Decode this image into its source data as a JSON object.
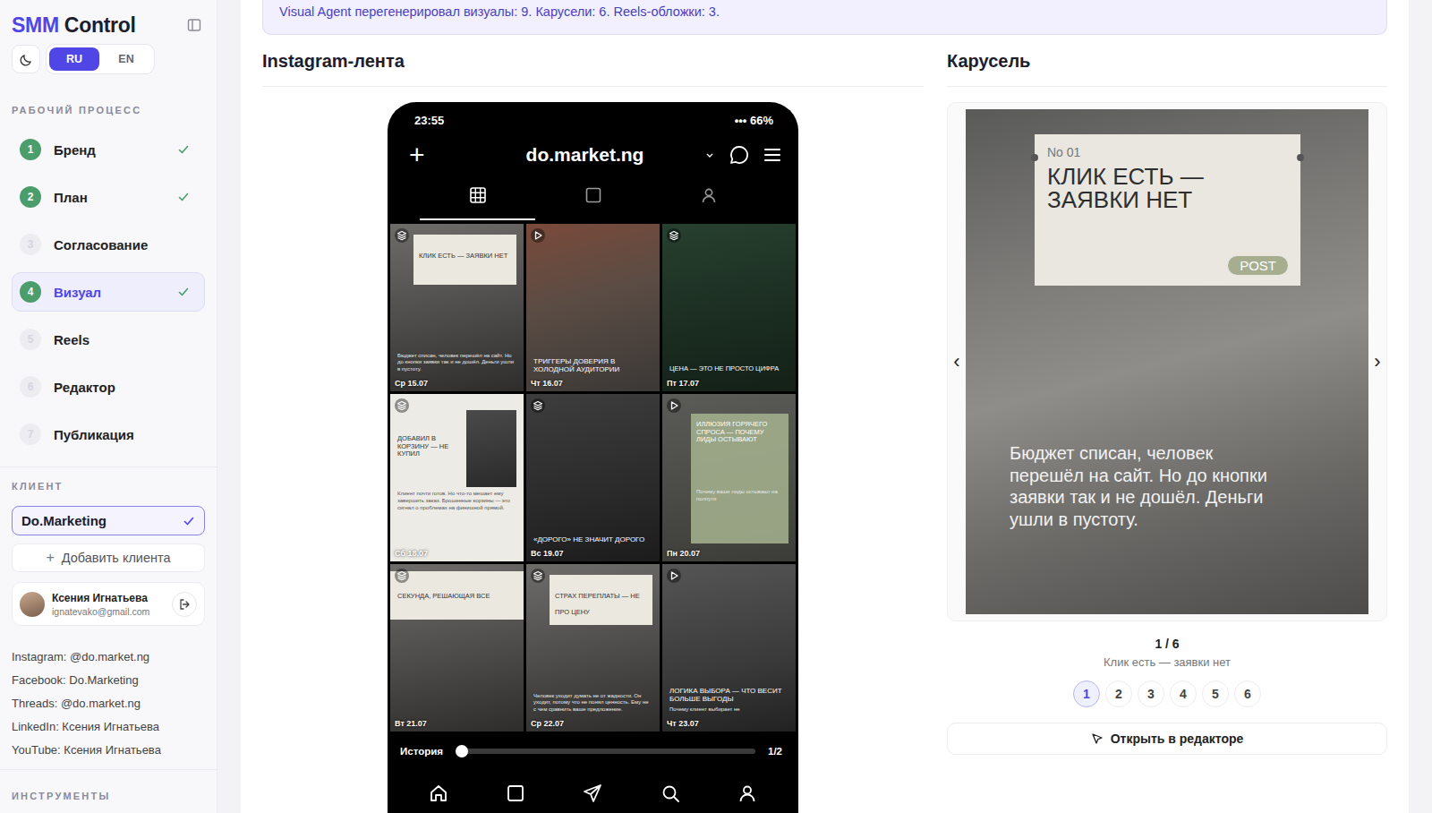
{
  "sidebar": {
    "logo": {
      "accent": "SMM",
      "rest": "Control"
    },
    "languages": [
      {
        "label": "RU",
        "selected": true
      },
      {
        "label": "EN",
        "selected": false
      }
    ],
    "workflow_label": "РАБОЧИЙ ПРОЦЕСС",
    "steps": [
      {
        "number": "1",
        "label": "Бренд",
        "done": true,
        "selected": false
      },
      {
        "number": "2",
        "label": "План",
        "done": true,
        "selected": false
      },
      {
        "number": "3",
        "label": "Согласование",
        "done": false,
        "selected": false
      },
      {
        "number": "4",
        "label": "Визуал",
        "done": true,
        "selected": true
      },
      {
        "number": "5",
        "label": "Reels",
        "done": false,
        "selected": false
      },
      {
        "number": "6",
        "label": "Редактор",
        "done": false,
        "selected": false
      },
      {
        "number": "7",
        "label": "Публикация",
        "done": false,
        "selected": false
      }
    ],
    "client_label": "КЛИЕНТ",
    "client": {
      "name": "Do.Marketing",
      "selected": true
    },
    "add_client": {
      "icon": "+",
      "label": "Добавить клиента"
    },
    "user": {
      "name": "Ксения Игнатьева",
      "email": "ignatevako@gmail.com"
    },
    "socials": [
      "Instagram: @do.market.ng",
      "Facebook: Do.Marketing",
      "Threads: @do.market.ng",
      "LinkedIn: Ксения Игнатьева",
      "YouTube: Ксения Игнатьева"
    ],
    "tools_label": "ИНСТРУМЕНТЫ"
  },
  "banner": "Visual Agent перегенерировал визуалы: 9. Карусели: 6. Reels-обложки: 3.",
  "feed": {
    "title": "Instagram-лента",
    "phone": {
      "time": "23:55",
      "signal": "•••",
      "battery": "66%",
      "new_icon": "+",
      "account": "do.market.ng",
      "profile_tabs": [
        {
          "selected": true
        },
        {
          "selected": false
        },
        {
          "selected": false
        }
      ],
      "posts": [
        {
          "kind": "carousel",
          "design": "card",
          "headline": "КЛИК ЕСТЬ — ЗАЯВКИ НЕТ",
          "body": "Бюджет списан, человек перешёл на сайт. Но до кнопки заявки так и не дошёл. Деньги ушли в пустоту.",
          "date": "Ср 15.07"
        },
        {
          "kind": "reel",
          "design": "photo",
          "headline": "ТРИГГЕРЫ ДОВЕРИЯ В ХОЛОДНОЙ АУДИТОРИИ",
          "body": "",
          "date": "Чт 16.07"
        },
        {
          "kind": "carousel",
          "design": "dark",
          "headline": "ЦЕНА — ЭТО НЕ ПРОСТО ЦИФРА",
          "body": "",
          "date": "Пт 17.07"
        },
        {
          "kind": "carousel",
          "design": "light",
          "headline": "ДОБАВИЛ В КОРЗИНУ — НЕ КУПИЛ",
          "body": "Клиент почти готов. Но что-то мешает ему завершить заказ. Брошенные корзины — это сигнал о проблемах на финишной прямой.",
          "date": "Сб 18.07"
        },
        {
          "kind": "carousel",
          "design": "photo",
          "headline": "«ДОРОГО» НЕ ЗНАЧИТ ДОРОГО",
          "body": "",
          "date": "Вс 19.07"
        },
        {
          "kind": "reel",
          "design": "tint",
          "headline": "ИЛЛЮЗИЯ ГОРЯЧЕГО СПРОСА — ПОЧЕМУ ЛИДЫ ОСТЫВАЮТ",
          "body": "Почему ваши лиды остывают на полпути",
          "date": "Пн 20.07"
        },
        {
          "kind": "carousel",
          "design": "band",
          "headline": "СЕКУНДА, РЕШАЮЩАЯ ВСЕ",
          "body": "",
          "date": "Вт 21.07"
        },
        {
          "kind": "carousel",
          "design": "card",
          "headline": "СТРАХ ПЕРЕПЛАТЫ — НЕ ПРО ЦЕНУ",
          "body": "Человек уходит думать не от жадности. Он уходит, потому что не понял ценность. Ему не с чем сравнить ваше предложение.",
          "date": "Ср 22.07"
        },
        {
          "kind": "reel",
          "design": "photo",
          "headline": "ЛОГИКА ВЫБОРА — ЧТО ВЕСИТ БОЛЬШЕ ВЫГОДЫ",
          "body": "Почему клиент выбирает не",
          "date": "Чт 23.07"
        }
      ],
      "stories": {
        "label": "История",
        "level": 0,
        "count": "1/2"
      }
    }
  },
  "carousel": {
    "title": "Карусель",
    "slide": {
      "number": "No 01",
      "headline": "КЛИК ЕСТЬ — ЗАЯВКИ НЕТ",
      "tag": "POST",
      "body": "Бюджет списан, человек перешёл на сайт. Но до кнопки заявки так и не дошёл. Деньги ушли в пустоту."
    },
    "prev": "‹",
    "next": "›",
    "counter": "1 / 6",
    "caption": "Клик есть — заявки нет",
    "pages": [
      {
        "label": "1",
        "selected": true
      },
      {
        "label": "2",
        "selected": false
      },
      {
        "label": "3",
        "selected": false
      },
      {
        "label": "4",
        "selected": false
      },
      {
        "label": "5",
        "selected": false
      },
      {
        "label": "6",
        "selected": false
      }
    ],
    "open_button": "Открыть в редакторе"
  }
}
